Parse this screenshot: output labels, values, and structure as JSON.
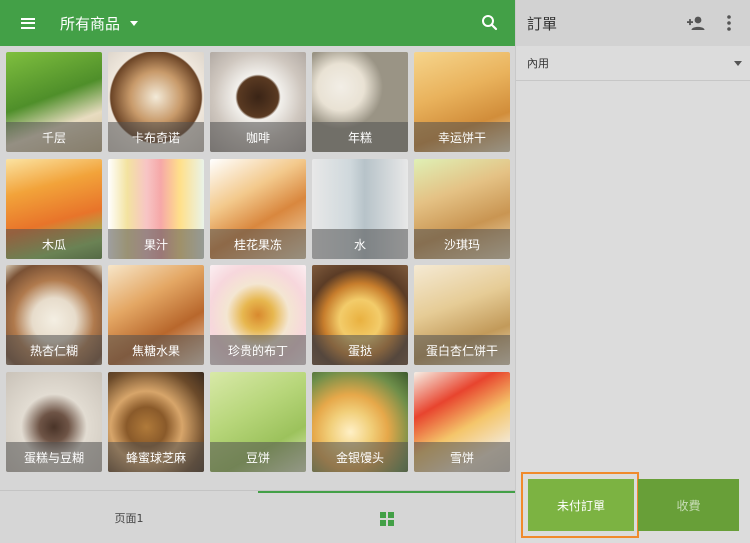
{
  "header": {
    "category_title": "所有商品"
  },
  "products": [
    {
      "name": "千层"
    },
    {
      "name": "卡布奇诺"
    },
    {
      "name": "咖啡"
    },
    {
      "name": "年糕"
    },
    {
      "name": "幸运饼干"
    },
    {
      "name": "木瓜"
    },
    {
      "name": "果汁"
    },
    {
      "name": "桂花果冻"
    },
    {
      "name": "水"
    },
    {
      "name": "沙琪玛"
    },
    {
      "name": "热杏仁糊"
    },
    {
      "name": "焦糖水果"
    },
    {
      "name": "珍贵的布丁"
    },
    {
      "name": "蛋挞"
    },
    {
      "name": "蛋白杏仁饼干"
    },
    {
      "name": "蛋糕与豆糊"
    },
    {
      "name": "蜂蜜球芝麻"
    },
    {
      "name": "豆饼"
    },
    {
      "name": "金银馒头"
    },
    {
      "name": "雪饼"
    }
  ],
  "bottom": {
    "page_label": "页面1"
  },
  "order": {
    "title": "訂單",
    "dining_type": "內用",
    "unpaid_label": "未付訂單",
    "charge_label": "收費"
  },
  "colors": {
    "primary": "#43a047",
    "unpaid_button": "#7cb342",
    "charge_button": "#689f38",
    "highlight": "#f08a2c"
  },
  "icons": {
    "menu": "menu-icon",
    "search": "search-icon",
    "dropdown": "caret-down-icon",
    "add_customer": "person-add-icon",
    "more": "more-vert-icon",
    "grid": "grid-icon"
  }
}
